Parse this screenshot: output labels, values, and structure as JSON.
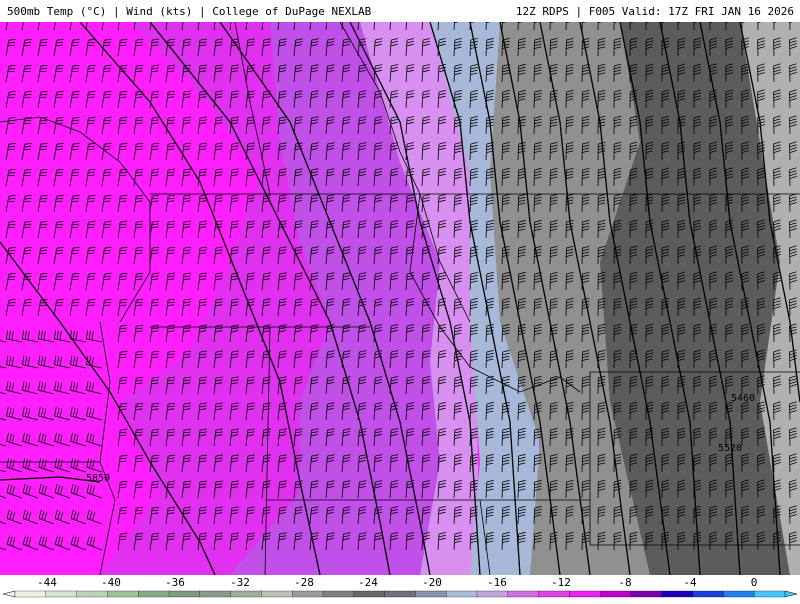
{
  "header": {
    "title_left": "500mb Temp (°C) | Wind (kts) | College of DuPage NEXLAB",
    "title_right": "12Z RDPS | F005 Valid: 17Z FRI JAN 16 2026"
  },
  "map": {
    "contour_labels": [
      "5850",
      "5460",
      "5520"
    ],
    "colors": {
      "temp_coldest": "#ff1fff",
      "temp_cold": "#e030f0",
      "temp_mid": "#c050e8",
      "temp_light": "#d890f0",
      "temp_blue": "#a8b8d8",
      "temp_gray": "#808080",
      "temp_dark": "#585858",
      "temp_lightgray": "#b0b0b0"
    }
  },
  "colorbar": {
    "tick_labels": [
      "-44",
      "-40",
      "-36",
      "-32",
      "-28",
      "-24",
      "-20",
      "-16",
      "-12",
      "-8",
      "-4",
      "0"
    ],
    "colors": [
      "#eef2ea",
      "#d4e4d0",
      "#b8d4b4",
      "#9cc49a",
      "#84ac84",
      "#7c9c7c",
      "#8c9c8c",
      "#a0aca0",
      "#b8c0b8",
      "#9c9c9c",
      "#808080",
      "#686868",
      "#70707c",
      "#8494ac",
      "#a8bcd8",
      "#c4a4dc",
      "#d070e0",
      "#e040e8",
      "#f020f8",
      "#c000d0",
      "#7c00b0",
      "#2000c0",
      "#1c40e0",
      "#2080f0",
      "#40c8f8"
    ]
  }
}
